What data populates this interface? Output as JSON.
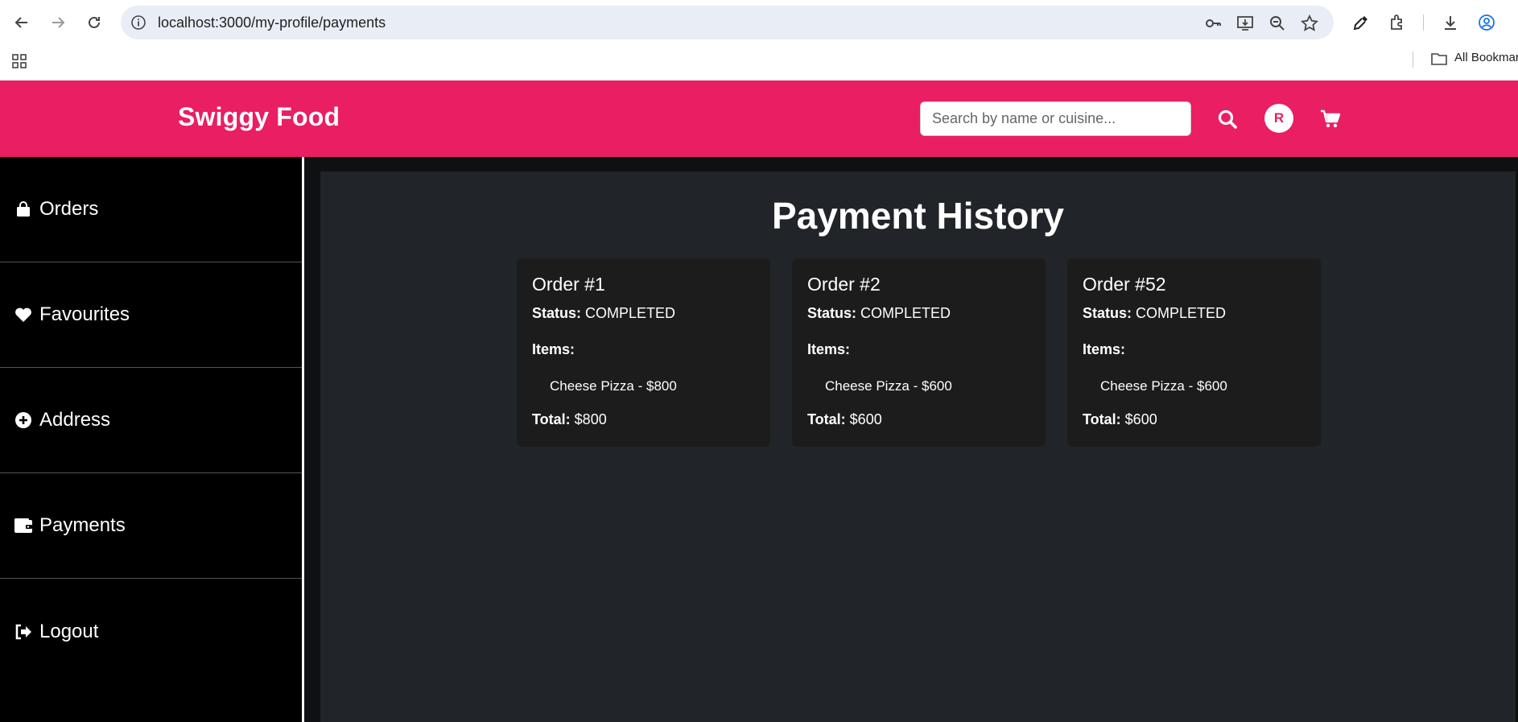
{
  "browser": {
    "url": "localhost:3000/my-profile/payments",
    "bookmarks_label": "All Bookmarks"
  },
  "header": {
    "brand": "Swiggy Food",
    "search_placeholder": "Search by name or cuisine...",
    "avatar_initial": "R"
  },
  "sidebar": {
    "items": [
      {
        "label": "Orders",
        "icon": "shopping-bag-icon"
      },
      {
        "label": "Favourites",
        "icon": "heart-icon"
      },
      {
        "label": "Address",
        "icon": "plus-circle-icon"
      },
      {
        "label": "Payments",
        "icon": "wallet-icon"
      },
      {
        "label": "Logout",
        "icon": "sign-out-icon"
      }
    ]
  },
  "main": {
    "title": "Payment History",
    "labels": {
      "status": "Status:",
      "items": "Items:",
      "total": "Total:"
    },
    "orders": [
      {
        "title": "Order #1",
        "status": "COMPLETED",
        "item": "Cheese Pizza - $800",
        "total": "$800"
      },
      {
        "title": "Order #2",
        "status": "COMPLETED",
        "item": "Cheese Pizza - $600",
        "total": "$600"
      },
      {
        "title": "Order #52",
        "status": "COMPLETED",
        "item": "Cheese Pizza - $600",
        "total": "$600"
      }
    ]
  },
  "colors": {
    "brand": "#e91e63",
    "sidebar_bg": "#000000",
    "content_bg": "#212428",
    "card_bg": "#1c1c1c"
  }
}
